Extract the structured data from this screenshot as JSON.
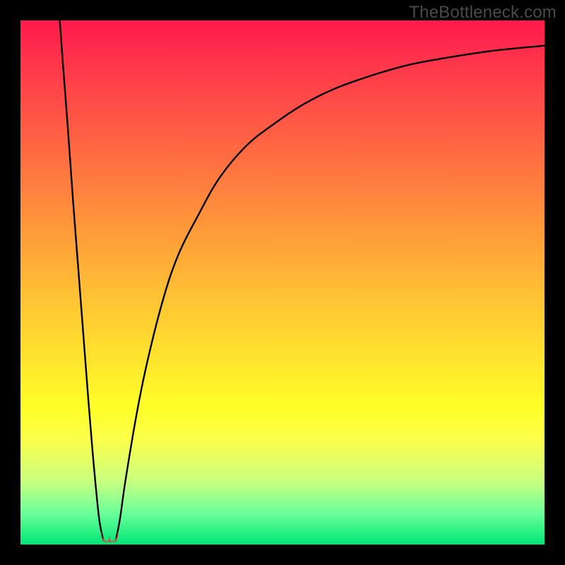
{
  "watermark": "TheBottleneck.com",
  "chart_data": {
    "type": "line",
    "title": "",
    "xlabel": "",
    "ylabel": "",
    "xlim": [
      0,
      100
    ],
    "ylim": [
      0,
      100
    ],
    "grid": false,
    "series": [
      {
        "name": "left-branch",
        "x": [
          7.5,
          8,
          9,
          10,
          11,
          12,
          13,
          14,
          15,
          15.8
        ],
        "values": [
          100,
          93,
          80,
          66,
          53,
          40,
          27,
          15,
          5,
          0.8
        ]
      },
      {
        "name": "right-branch",
        "x": [
          18.2,
          19,
          20,
          22,
          24,
          27,
          30,
          34,
          38,
          43,
          48,
          54,
          60,
          67,
          74,
          82,
          90,
          100
        ],
        "values": [
          0.8,
          5,
          12,
          24,
          34,
          46,
          55,
          63,
          70,
          76,
          80,
          84,
          87,
          89.5,
          91.5,
          93,
          94.2,
          95.2
        ]
      }
    ],
    "marker": {
      "x": 17,
      "y": 0.5,
      "shape": "double-lobe",
      "color": "#c25a50"
    }
  },
  "gradient_stops": [
    {
      "pos": 0,
      "color": "#ff1a4d"
    },
    {
      "pos": 50,
      "color": "#ffc034"
    },
    {
      "pos": 75,
      "color": "#ffff28"
    },
    {
      "pos": 100,
      "color": "#00e676"
    }
  ]
}
